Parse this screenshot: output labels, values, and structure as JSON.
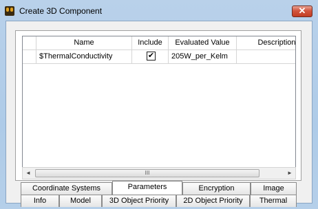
{
  "window": {
    "title": "Create 3D Component",
    "close_symbol": "✕"
  },
  "table": {
    "headers": [
      "Name",
      "Include",
      "Evaluated Value",
      "Description"
    ],
    "rows": [
      {
        "name": "$ThermalConductivity",
        "include": "✔",
        "value": "205W_per_Kelm",
        "description": ""
      }
    ]
  },
  "scrollbar": {
    "left_arrow": "◄",
    "right_arrow": "►",
    "thumb_grip": "III"
  },
  "tabs": {
    "row_top": [
      "Coordinate Systems",
      "Parameters",
      "Encryption",
      "Image"
    ],
    "row_bottom": [
      "Info",
      "Model",
      "3D Object Priority",
      "2D Object Priority",
      "Thermal"
    ],
    "active": "Parameters"
  },
  "icons": {
    "app": "app-logo-icon",
    "close": "close-icon",
    "checkbox": "checkbox-checked-icon"
  }
}
